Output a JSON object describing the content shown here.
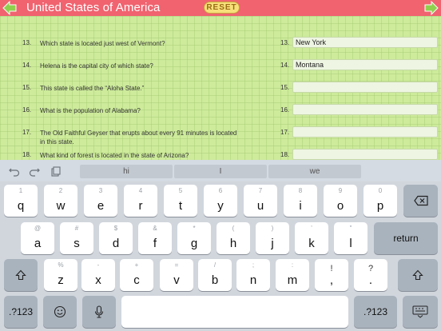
{
  "header": {
    "title": "United States of America",
    "reset_label": "RESET"
  },
  "questions": [
    {
      "num": "13.",
      "text": "Which state is located just west of Vermont?",
      "answer_num": "13.",
      "answer": "New York"
    },
    {
      "num": "14.",
      "text": "Helena is the capital city of which state?",
      "answer_num": "14.",
      "answer": "Montana"
    },
    {
      "num": "15.",
      "text": "This state is called the “Aloha State.”",
      "answer_num": "15.",
      "answer": ""
    },
    {
      "num": "16.",
      "text": "What is the population of Alabama?",
      "answer_num": "16.",
      "answer": ""
    },
    {
      "num": "17.",
      "text": "The Old Faithful Geyser that erupts about every 91 minutes is located in this state.",
      "answer_num": "17.",
      "answer": ""
    },
    {
      "num": "18.",
      "text": "What kind of forest is located in the state of Arizona?",
      "answer_num": "18.",
      "answer": ""
    }
  ],
  "suggestions": [
    "hi",
    "I",
    "we"
  ],
  "keys": {
    "row1": [
      {
        "sub": "1",
        "main": "q"
      },
      {
        "sub": "2",
        "main": "w"
      },
      {
        "sub": "3",
        "main": "e"
      },
      {
        "sub": "4",
        "main": "r"
      },
      {
        "sub": "5",
        "main": "t"
      },
      {
        "sub": "6",
        "main": "y"
      },
      {
        "sub": "7",
        "main": "u"
      },
      {
        "sub": "8",
        "main": "i"
      },
      {
        "sub": "9",
        "main": "o"
      },
      {
        "sub": "0",
        "main": "p"
      }
    ],
    "row2": [
      {
        "sub": "@",
        "main": "a"
      },
      {
        "sub": "#",
        "main": "s"
      },
      {
        "sub": "$",
        "main": "d"
      },
      {
        "sub": "&",
        "main": "f"
      },
      {
        "sub": "*",
        "main": "g"
      },
      {
        "sub": "(",
        "main": "h"
      },
      {
        "sub": ")",
        "main": "j"
      },
      {
        "sub": "’",
        "main": "k"
      },
      {
        "sub": "\"",
        "main": "l"
      }
    ],
    "row3": [
      {
        "sub": "%",
        "main": "z"
      },
      {
        "sub": "-",
        "main": "x"
      },
      {
        "sub": "+",
        "main": "c"
      },
      {
        "sub": "=",
        "main": "v"
      },
      {
        "sub": "/",
        "main": "b"
      },
      {
        "sub": ";",
        "main": "n"
      },
      {
        "sub": ":",
        "main": "m"
      },
      {
        "sub": "!",
        "main": ","
      },
      {
        "sub": "?",
        "main": "."
      }
    ],
    "return_label": "return",
    "numbers_label": ".?123"
  }
}
